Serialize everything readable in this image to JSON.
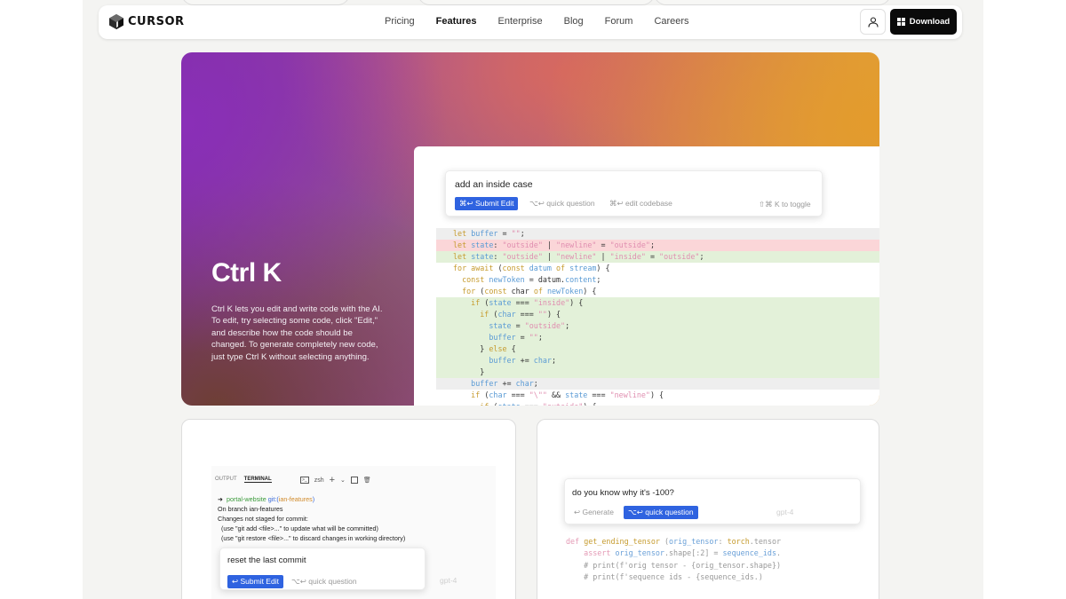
{
  "nav": {
    "logo_text": "CURSOR",
    "links": [
      "Pricing",
      "Features",
      "Enterprise",
      "Blog",
      "Forum",
      "Careers"
    ],
    "active_link": "Features",
    "download_label": "Download"
  },
  "hero": {
    "title": "Ctrl K",
    "description": "Ctrl K lets you edit and write code with the AI. To edit, try selecting some code, click \"Edit,\" and describe how the code should be changed. To generate completely new code, just type Ctrl K without selecting anything.",
    "prompt_text": "add an inside case",
    "submit_label": "⌘↩ Submit Edit",
    "quick_question_label": "⌥↩ quick question",
    "edit_codebase_label": "⌘↩ edit codebase",
    "toggle_label": "⇧⌘ K to toggle"
  },
  "terminal_card": {
    "tab_output": "OUTPUT",
    "tab_terminal": "TERMINAL",
    "shell": "zsh",
    "lines": {
      "prompt_dir": "portal-website",
      "git_label": "git:(",
      "branch": "ian-features",
      "git_close": ")",
      "l2": "On branch ian-features",
      "l3": "Changes not staged for commit:",
      "l4": "(use \"git add <file>...\" to update what will be committed)",
      "l5": "(use \"git restore <file>...\" to discard changes in working directory)"
    },
    "ask_text": "reset the last commit",
    "submit_label": "↩ Submit Edit",
    "quick_question_label": "⌥↩ quick question",
    "faded_model": "gpt-4"
  },
  "chat_card": {
    "ask_text": "do you know why it's -100?",
    "generate_label": "↩ Generate",
    "quick_question_label": "⌥↩ quick question",
    "faded_model": "gpt-4"
  }
}
